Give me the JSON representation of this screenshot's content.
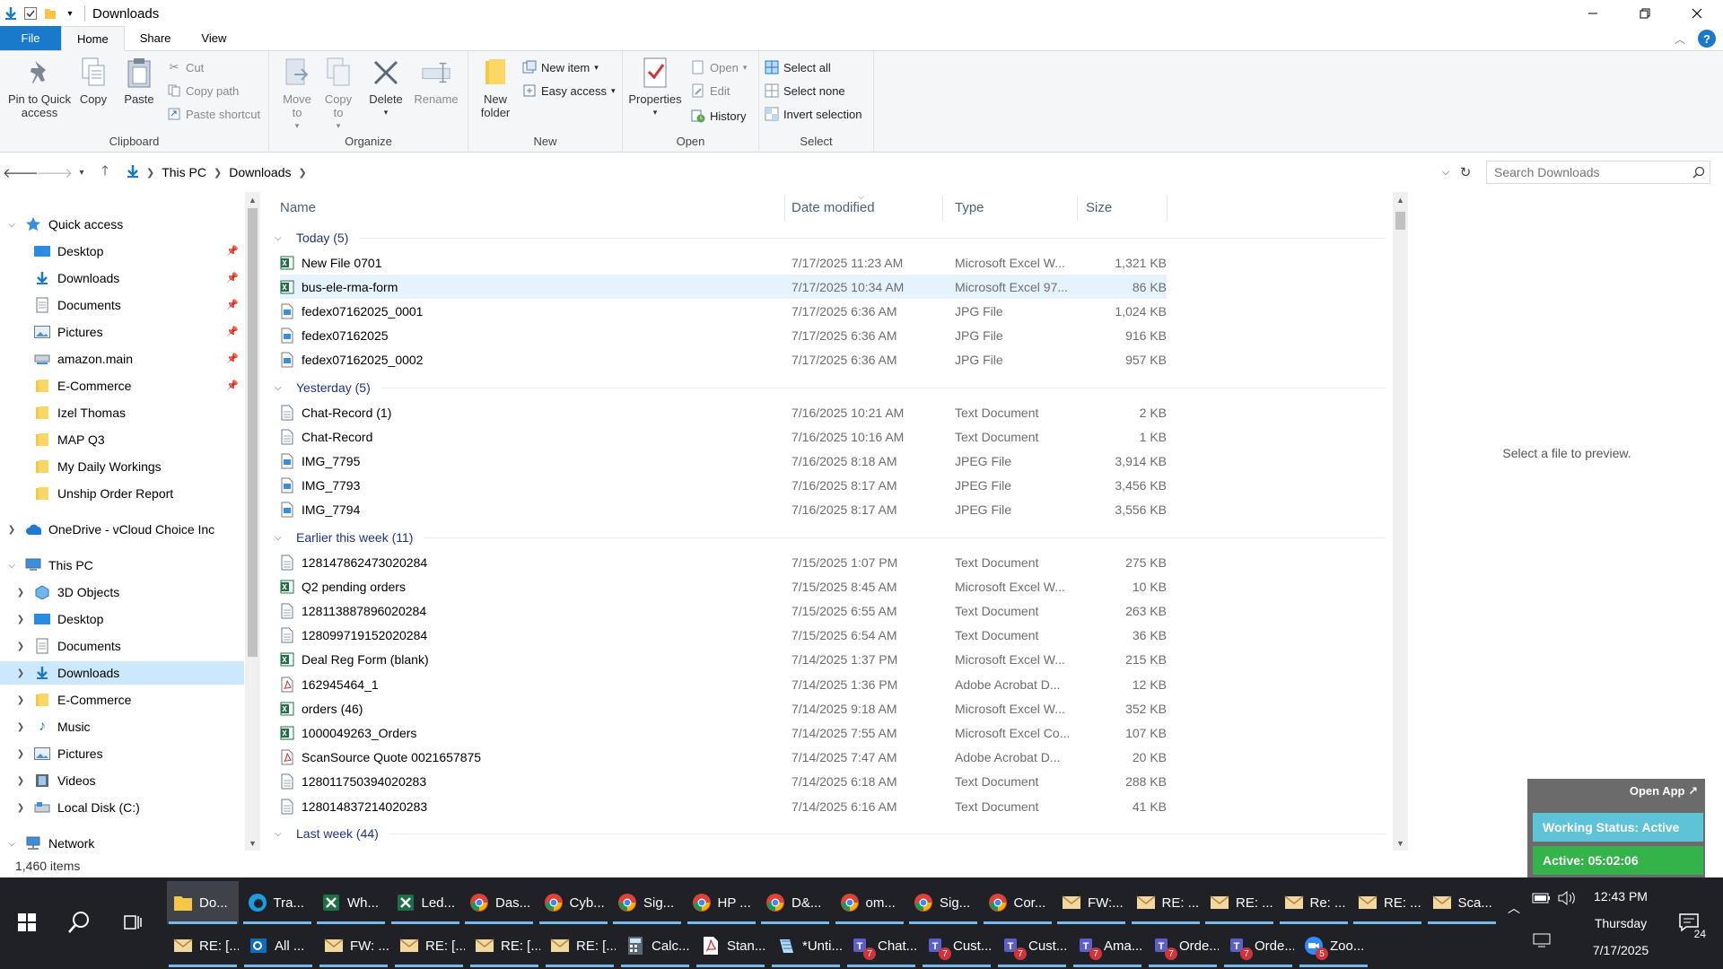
{
  "window": {
    "title": "Downloads"
  },
  "ribbon": {
    "tabs": [
      "File",
      "Home",
      "Share",
      "View"
    ],
    "clipboard": {
      "label": "Clipboard",
      "pin": "Pin to Quick access",
      "copy": "Copy",
      "paste": "Paste",
      "cut": "Cut",
      "copy_path": "Copy path",
      "paste_shortcut": "Paste shortcut"
    },
    "organize": {
      "label": "Organize",
      "move_to": "Move to",
      "copy_to": "Copy to",
      "delete": "Delete",
      "rename": "Rename"
    },
    "new": {
      "label": "New",
      "new_folder": "New folder",
      "new_item": "New item",
      "easy_access": "Easy access"
    },
    "open": {
      "label": "Open",
      "properties": "Properties",
      "open": "Open",
      "edit": "Edit",
      "history": "History"
    },
    "select": {
      "label": "Select",
      "select_all": "Select all",
      "select_none": "Select none",
      "invert": "Invert selection"
    }
  },
  "address": {
    "crumbs": [
      "This PC",
      "Downloads"
    ]
  },
  "search": {
    "placeholder": "Search Downloads"
  },
  "nav": {
    "quick_access": "Quick access",
    "quick_items": [
      "Desktop",
      "Downloads",
      "Documents",
      "Pictures",
      "amazon.main",
      "E-Commerce",
      "Izel Thomas",
      "MAP Q3",
      "My Daily Workings",
      "Unship Order Report"
    ],
    "onedrive": "OneDrive - vCloud Choice Inc",
    "this_pc": "This PC",
    "pc_items": [
      "3D Objects",
      "Desktop",
      "Documents",
      "Downloads",
      "E-Commerce",
      "Music",
      "Pictures",
      "Videos",
      "Local Disk (C:)"
    ],
    "network": "Network"
  },
  "columns": {
    "name": "Name",
    "date": "Date modified",
    "type": "Type",
    "size": "Size"
  },
  "groups": [
    {
      "header": "Today (5)",
      "files": [
        {
          "name": "New File 0701",
          "date": "7/17/2025 11:23 AM",
          "type": "Microsoft Excel W...",
          "size": "1,321 KB",
          "icon": "excel"
        },
        {
          "name": "bus-ele-rma-form",
          "date": "7/17/2025 10:34 AM",
          "type": "Microsoft Excel 97...",
          "size": "86 KB",
          "icon": "excel"
        },
        {
          "name": "fedex07162025_0001",
          "date": "7/17/2025 6:36 AM",
          "type": "JPG File",
          "size": "1,024 KB",
          "icon": "image"
        },
        {
          "name": "fedex07162025",
          "date": "7/17/2025 6:36 AM",
          "type": "JPG File",
          "size": "916 KB",
          "icon": "image"
        },
        {
          "name": "fedex07162025_0002",
          "date": "7/17/2025 6:36 AM",
          "type": "JPG File",
          "size": "957 KB",
          "icon": "image"
        }
      ]
    },
    {
      "header": "Yesterday (5)",
      "files": [
        {
          "name": "Chat-Record (1)",
          "date": "7/16/2025 10:21 AM",
          "type": "Text Document",
          "size": "2 KB",
          "icon": "text"
        },
        {
          "name": "Chat-Record",
          "date": "7/16/2025 10:16 AM",
          "type": "Text Document",
          "size": "1 KB",
          "icon": "text"
        },
        {
          "name": "IMG_7795",
          "date": "7/16/2025 8:18 AM",
          "type": "JPEG File",
          "size": "3,914 KB",
          "icon": "image"
        },
        {
          "name": "IMG_7793",
          "date": "7/16/2025 8:17 AM",
          "type": "JPEG File",
          "size": "3,456 KB",
          "icon": "image"
        },
        {
          "name": "IMG_7794",
          "date": "7/16/2025 8:17 AM",
          "type": "JPEG File",
          "size": "3,556 KB",
          "icon": "image"
        }
      ]
    },
    {
      "header": "Earlier this week (11)",
      "files": [
        {
          "name": "128147862473020284",
          "date": "7/15/2025 1:07 PM",
          "type": "Text Document",
          "size": "275 KB",
          "icon": "text"
        },
        {
          "name": "Q2 pending orders",
          "date": "7/15/2025 8:45 AM",
          "type": "Microsoft Excel W...",
          "size": "10 KB",
          "icon": "excel"
        },
        {
          "name": "128113887896020284",
          "date": "7/15/2025 6:55 AM",
          "type": "Text Document",
          "size": "263 KB",
          "icon": "text"
        },
        {
          "name": "128099719152020284",
          "date": "7/15/2025 6:54 AM",
          "type": "Text Document",
          "size": "36 KB",
          "icon": "text"
        },
        {
          "name": "Deal Reg Form (blank)",
          "date": "7/14/2025 1:37 PM",
          "type": "Microsoft Excel W...",
          "size": "215 KB",
          "icon": "excel"
        },
        {
          "name": "162945464_1",
          "date": "7/14/2025 1:36 PM",
          "type": "Adobe Acrobat D...",
          "size": "12 KB",
          "icon": "pdf"
        },
        {
          "name": "orders (46)",
          "date": "7/14/2025 9:18 AM",
          "type": "Microsoft Excel W...",
          "size": "352 KB",
          "icon": "excel"
        },
        {
          "name": "1000049263_Orders",
          "date": "7/14/2025 7:55 AM",
          "type": "Microsoft Excel Co...",
          "size": "107 KB",
          "icon": "excel"
        },
        {
          "name": "ScanSource Quote 0021657875",
          "date": "7/14/2025 7:47 AM",
          "type": "Adobe Acrobat D...",
          "size": "20 KB",
          "icon": "pdf"
        },
        {
          "name": "128011750394020283",
          "date": "7/14/2025 6:18 AM",
          "type": "Text Document",
          "size": "288 KB",
          "icon": "text"
        },
        {
          "name": "128014837214020283",
          "date": "7/14/2025 6:16 AM",
          "type": "Text Document",
          "size": "41 KB",
          "icon": "text"
        }
      ]
    },
    {
      "header": "Last week (44)",
      "files": []
    }
  ],
  "preview": {
    "text": "Select a file to preview."
  },
  "status": {
    "items": "1,460 items"
  },
  "widget": {
    "open_app": "Open App",
    "status": "Working Status: Active",
    "timer": "Active: 05:02:06"
  },
  "taskbar": {
    "row1": [
      {
        "label": "Do...",
        "icon": "folder",
        "active": true
      },
      {
        "label": "Tra...",
        "icon": "edge"
      },
      {
        "label": "Wh...",
        "icon": "excel"
      },
      {
        "label": "Led...",
        "icon": "excel"
      },
      {
        "label": "Das...",
        "icon": "chrome"
      },
      {
        "label": "Cyb...",
        "icon": "chrome"
      },
      {
        "label": "Sig...",
        "icon": "chrome"
      },
      {
        "label": "HP ...",
        "icon": "chrome"
      },
      {
        "label": "D&...",
        "icon": "chrome"
      },
      {
        "label": "om...",
        "icon": "chrome"
      },
      {
        "label": "Sig...",
        "icon": "chrome"
      },
      {
        "label": "Cor...",
        "icon": "chrome"
      },
      {
        "label": "FW:...",
        "icon": "mail"
      },
      {
        "label": "RE: ...",
        "icon": "mail"
      },
      {
        "label": "RE: ...",
        "icon": "mail"
      },
      {
        "label": "Re: ...",
        "icon": "mail"
      },
      {
        "label": "RE: ...",
        "icon": "mail"
      },
      {
        "label": "Sca...",
        "icon": "mail"
      }
    ],
    "row2": [
      {
        "label": "RE: [...",
        "icon": "mail"
      },
      {
        "label": "All ...",
        "icon": "outlook"
      },
      {
        "label": "FW: ...",
        "icon": "mail"
      },
      {
        "label": "RE: [...",
        "icon": "mail"
      },
      {
        "label": "RE: [...",
        "icon": "mail"
      },
      {
        "label": "RE: [...",
        "icon": "mail"
      },
      {
        "label": "Calc...",
        "icon": "calc"
      },
      {
        "label": "Stan...",
        "icon": "pdf"
      },
      {
        "label": "*Unti...",
        "icon": "notepad"
      },
      {
        "label": "Chat...",
        "icon": "teams",
        "badge": "7"
      },
      {
        "label": "Cust...",
        "icon": "teams",
        "badge": "7"
      },
      {
        "label": "Cust...",
        "icon": "teams",
        "badge": "7"
      },
      {
        "label": "Ama...",
        "icon": "teams",
        "badge": "7"
      },
      {
        "label": "Orde...",
        "icon": "teams",
        "badge": "7"
      },
      {
        "label": "Orde...",
        "icon": "teams",
        "badge": "7"
      },
      {
        "label": "Zoo...",
        "icon": "zoom",
        "badge": "5"
      }
    ],
    "time": "12:43 PM",
    "day": "Thursday",
    "date": "7/17/2025",
    "notifications": "24"
  }
}
